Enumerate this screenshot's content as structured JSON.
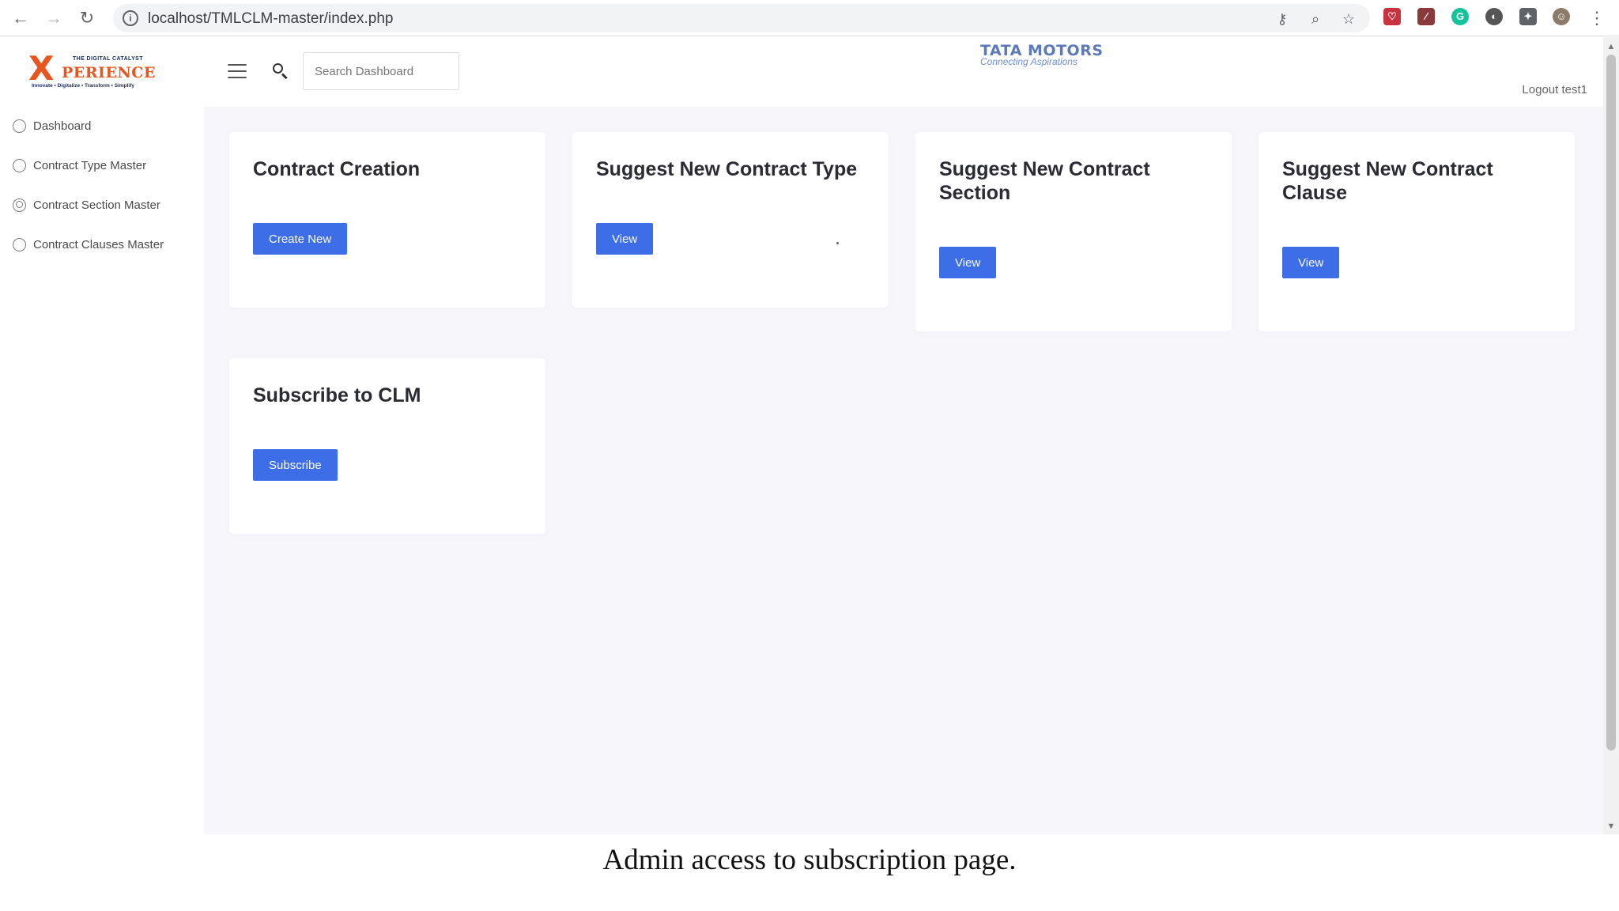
{
  "browser": {
    "url": "localhost/TMLCLM-master/index.php",
    "back_icon": "←",
    "forward_icon": "→",
    "reload_icon": "↻",
    "info_icon": "i",
    "key_icon": "⚷",
    "zoom_icon": "⌕",
    "star_icon": "☆",
    "menu_icon": "⋮",
    "ext_pocket": "♡",
    "ext_pdf": "⁄",
    "ext_grammarly": "G",
    "ext_circle": "◐",
    "ext_puzzle": "✦",
    "ext_profile": "☺"
  },
  "sidebar": {
    "logo": {
      "mark": "X",
      "word": "PERIENCE",
      "tag_top": "THE DIGITAL CATALYST",
      "tag_bottom": "Innovate • Digitalize • Transform • Simplify"
    },
    "items": [
      {
        "label": "Dashboard",
        "icon": "dashboard-icon"
      },
      {
        "label": "Contract Type Master",
        "icon": "lightbulb-icon"
      },
      {
        "label": "Contract Section Master",
        "icon": "user-icon"
      },
      {
        "label": "Contract Clauses Master",
        "icon": "lightbulb-icon"
      }
    ]
  },
  "header": {
    "search_placeholder": "Search Dashboard",
    "brand_name": "TATA MOTORS",
    "brand_tagline": "Connecting Aspirations",
    "logout_label": "Logout test1"
  },
  "cards": [
    {
      "title": "Contract Creation",
      "button": "Create New"
    },
    {
      "title": "Suggest New Contract Type",
      "button": "View"
    },
    {
      "title": "Suggest New Contract Section",
      "button": "View"
    },
    {
      "title": "Suggest New Contract Clause",
      "button": "View"
    },
    {
      "title": "Subscribe to CLM",
      "button": "Subscribe"
    }
  ],
  "scrollbar": {
    "up": "▲",
    "down": "▼"
  },
  "caption": "Admin access to subscription page.",
  "colors": {
    "accent": "#3d6ee8",
    "brand_orange": "#e8551e",
    "brand_blue": "#2f55a4"
  }
}
